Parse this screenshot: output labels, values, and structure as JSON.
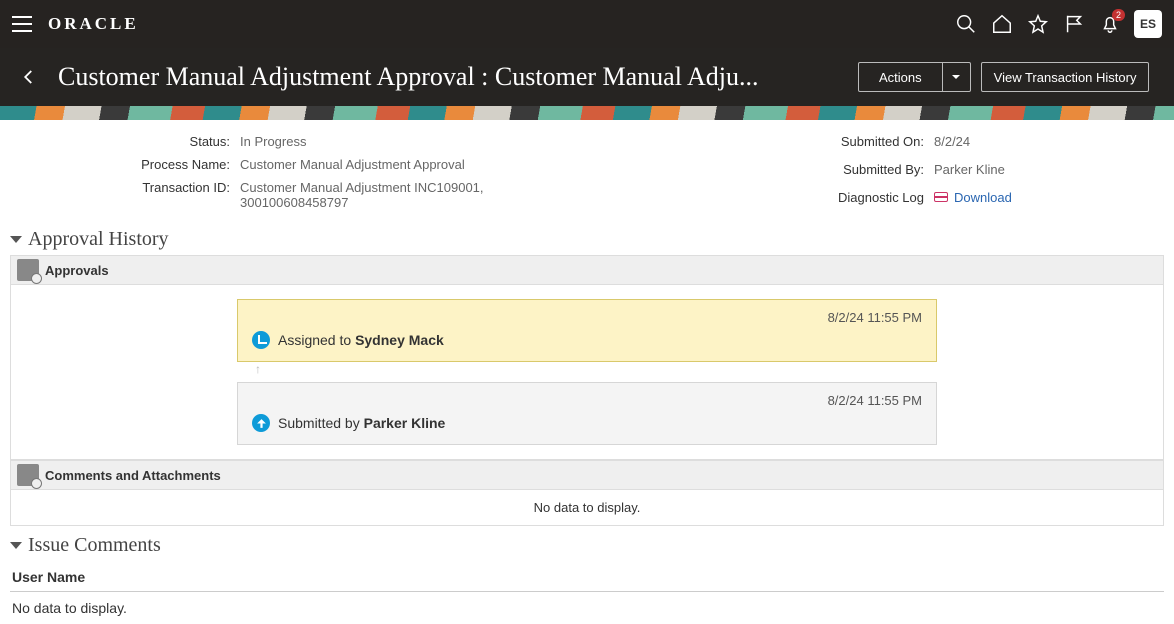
{
  "brand": "ORACLE",
  "user_initials": "ES",
  "notification_badge": "2",
  "page_title": "Customer Manual Adjustment Approval : Customer Manual Adju...",
  "actions_label": "Actions",
  "view_history_label": "View Transaction History",
  "details": {
    "status_label": "Status:",
    "status_value": "In Progress",
    "process_name_label": "Process Name:",
    "process_name_value": "Customer Manual Adjustment Approval",
    "transaction_id_label": "Transaction ID:",
    "transaction_id_value": "Customer Manual Adjustment INC109001, 300100608458797",
    "submitted_on_label": "Submitted On:",
    "submitted_on_value": "8/2/24",
    "submitted_by_label": "Submitted By:",
    "submitted_by_value": "Parker Kline",
    "diagnostic_log_label": "Diagnostic Log",
    "diagnostic_download": "Download"
  },
  "sections": {
    "approval_history": "Approval History",
    "approvals": "Approvals",
    "comments_attachments": "Comments and Attachments",
    "no_data": "No data to display.",
    "issue_comments": "Issue Comments"
  },
  "timeline": {
    "assigned": {
      "timestamp": "8/2/24 11:55 PM",
      "prefix": "Assigned to ",
      "name": "Sydney Mack"
    },
    "submitted": {
      "timestamp": "8/2/24 11:55 PM",
      "prefix": "Submitted by ",
      "name": "Parker Kline"
    }
  },
  "issue_table": {
    "col_user": "User Name",
    "empty": "No data to display."
  }
}
